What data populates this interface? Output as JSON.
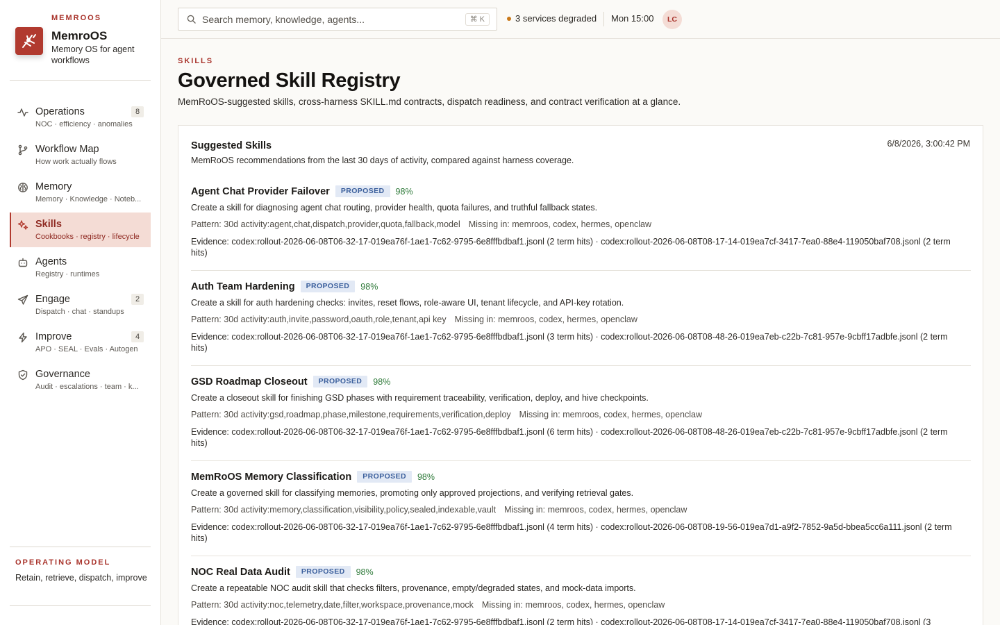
{
  "brand": {
    "eyebrow": "MEMROOS",
    "name": "MemroOS",
    "tagline": "Memory OS for agent workflows"
  },
  "nav": [
    {
      "icon": "pulse-icon",
      "title": "Operations",
      "sub": "NOC · efficiency · anomalies",
      "badge": "8",
      "active": false
    },
    {
      "icon": "git-branch-icon",
      "title": "Workflow Map",
      "sub": "How work actually flows",
      "badge": "",
      "active": false
    },
    {
      "icon": "brain-icon",
      "title": "Memory",
      "sub": "Memory · Knowledge · Noteb...",
      "badge": "",
      "active": false
    },
    {
      "icon": "sparkles-icon",
      "title": "Skills",
      "sub": "Cookbooks · registry · lifecycle",
      "badge": "",
      "active": true
    },
    {
      "icon": "bot-icon",
      "title": "Agents",
      "sub": "Registry · runtimes",
      "badge": "",
      "active": false
    },
    {
      "icon": "send-icon",
      "title": "Engage",
      "sub": "Dispatch · chat · standups",
      "badge": "2",
      "active": false
    },
    {
      "icon": "bolt-icon",
      "title": "Improve",
      "sub": "APO · SEAL · Evals · Autogen",
      "badge": "4",
      "active": false
    },
    {
      "icon": "shield-check-icon",
      "title": "Governance",
      "sub": "Audit · escalations · team · k...",
      "badge": "",
      "active": false
    }
  ],
  "operating_model": {
    "eyebrow": "OPERATING MODEL",
    "text": "Retain, retrieve, dispatch, improve"
  },
  "topbar": {
    "search_placeholder": "Search memory, knowledge, agents...",
    "search_shortcut": "⌘ K",
    "status": "3 services degraded",
    "status_color": "#c97818",
    "time": "Mon 15:00",
    "avatar": "LC"
  },
  "page": {
    "eyebrow": "SKILLS",
    "title": "Governed Skill Registry",
    "description": "MemRoOS-suggested skills, cross-harness SKILL.md contracts, dispatch readiness, and contract verification at a glance."
  },
  "panel": {
    "title": "Suggested Skills",
    "date": "6/8/2026, 3:00:42 PM",
    "subtitle": "MemRoOS recommendations from the last 30 days of activity, compared against harness coverage."
  },
  "skills": [
    {
      "name": "Agent Chat Provider Failover",
      "status": "PROPOSED",
      "score": "98%",
      "description": "Create a skill for diagnosing agent chat routing, provider health, quota failures, and truthful fallback states.",
      "pattern": "Pattern: 30d activity:agent,chat,dispatch,provider,quota,fallback,model",
      "missing": "Missing in: memroos, codex, hermes, openclaw",
      "evidence": "Evidence: codex:rollout-2026-06-08T06-32-17-019ea76f-1ae1-7c62-9795-6e8fffbdbaf1.jsonl (2 term hits) · codex:rollout-2026-06-08T08-17-14-019ea7cf-3417-7ea0-88e4-119050baf708.jsonl (2 term hits)"
    },
    {
      "name": "Auth Team Hardening",
      "status": "PROPOSED",
      "score": "98%",
      "description": "Create a skill for auth hardening checks: invites, reset flows, role-aware UI, tenant lifecycle, and API-key rotation.",
      "pattern": "Pattern: 30d activity:auth,invite,password,oauth,role,tenant,api key",
      "missing": "Missing in: memroos, codex, hermes, openclaw",
      "evidence": "Evidence: codex:rollout-2026-06-08T06-32-17-019ea76f-1ae1-7c62-9795-6e8fffbdbaf1.jsonl (3 term hits) · codex:rollout-2026-06-08T08-48-26-019ea7eb-c22b-7c81-957e-9cbff17adbfe.jsonl (2 term hits)"
    },
    {
      "name": "GSD Roadmap Closeout",
      "status": "PROPOSED",
      "score": "98%",
      "description": "Create a closeout skill for finishing GSD phases with requirement traceability, verification, deploy, and hive checkpoints.",
      "pattern": "Pattern: 30d activity:gsd,roadmap,phase,milestone,requirements,verification,deploy",
      "missing": "Missing in: memroos, codex, hermes, openclaw",
      "evidence": "Evidence: codex:rollout-2026-06-08T06-32-17-019ea76f-1ae1-7c62-9795-6e8fffbdbaf1.jsonl (6 term hits) · codex:rollout-2026-06-08T08-48-26-019ea7eb-c22b-7c81-957e-9cbff17adbfe.jsonl (2 term hits)"
    },
    {
      "name": "MemRoOS Memory Classification",
      "status": "PROPOSED",
      "score": "98%",
      "description": "Create a governed skill for classifying memories, promoting only approved projections, and verifying retrieval gates.",
      "pattern": "Pattern: 30d activity:memory,classification,visibility,policy,sealed,indexable,vault",
      "missing": "Missing in: memroos, codex, hermes, openclaw",
      "evidence": "Evidence: codex:rollout-2026-06-08T06-32-17-019ea76f-1ae1-7c62-9795-6e8fffbdbaf1.jsonl (4 term hits) · codex:rollout-2026-06-08T08-19-56-019ea7d1-a9f2-7852-9a5d-bbea5cc6a111.jsonl (2 term hits)"
    },
    {
      "name": "NOC Real Data Audit",
      "status": "PROPOSED",
      "score": "98%",
      "description": "Create a repeatable NOC audit skill that checks filters, provenance, empty/degraded states, and mock-data imports.",
      "pattern": "Pattern: 30d activity:noc,telemetry,date,filter,workspace,provenance,mock",
      "missing": "Missing in: memroos, codex, hermes, openclaw",
      "evidence": "Evidence: codex:rollout-2026-06-08T06-32-17-019ea76f-1ae1-7c62-9795-6e8fffbdbaf1.jsonl (2 term hits) · codex:rollout-2026-06-08T08-17-14-019ea7cf-3417-7ea0-88e4-119050baf708.jsonl (3"
    }
  ]
}
